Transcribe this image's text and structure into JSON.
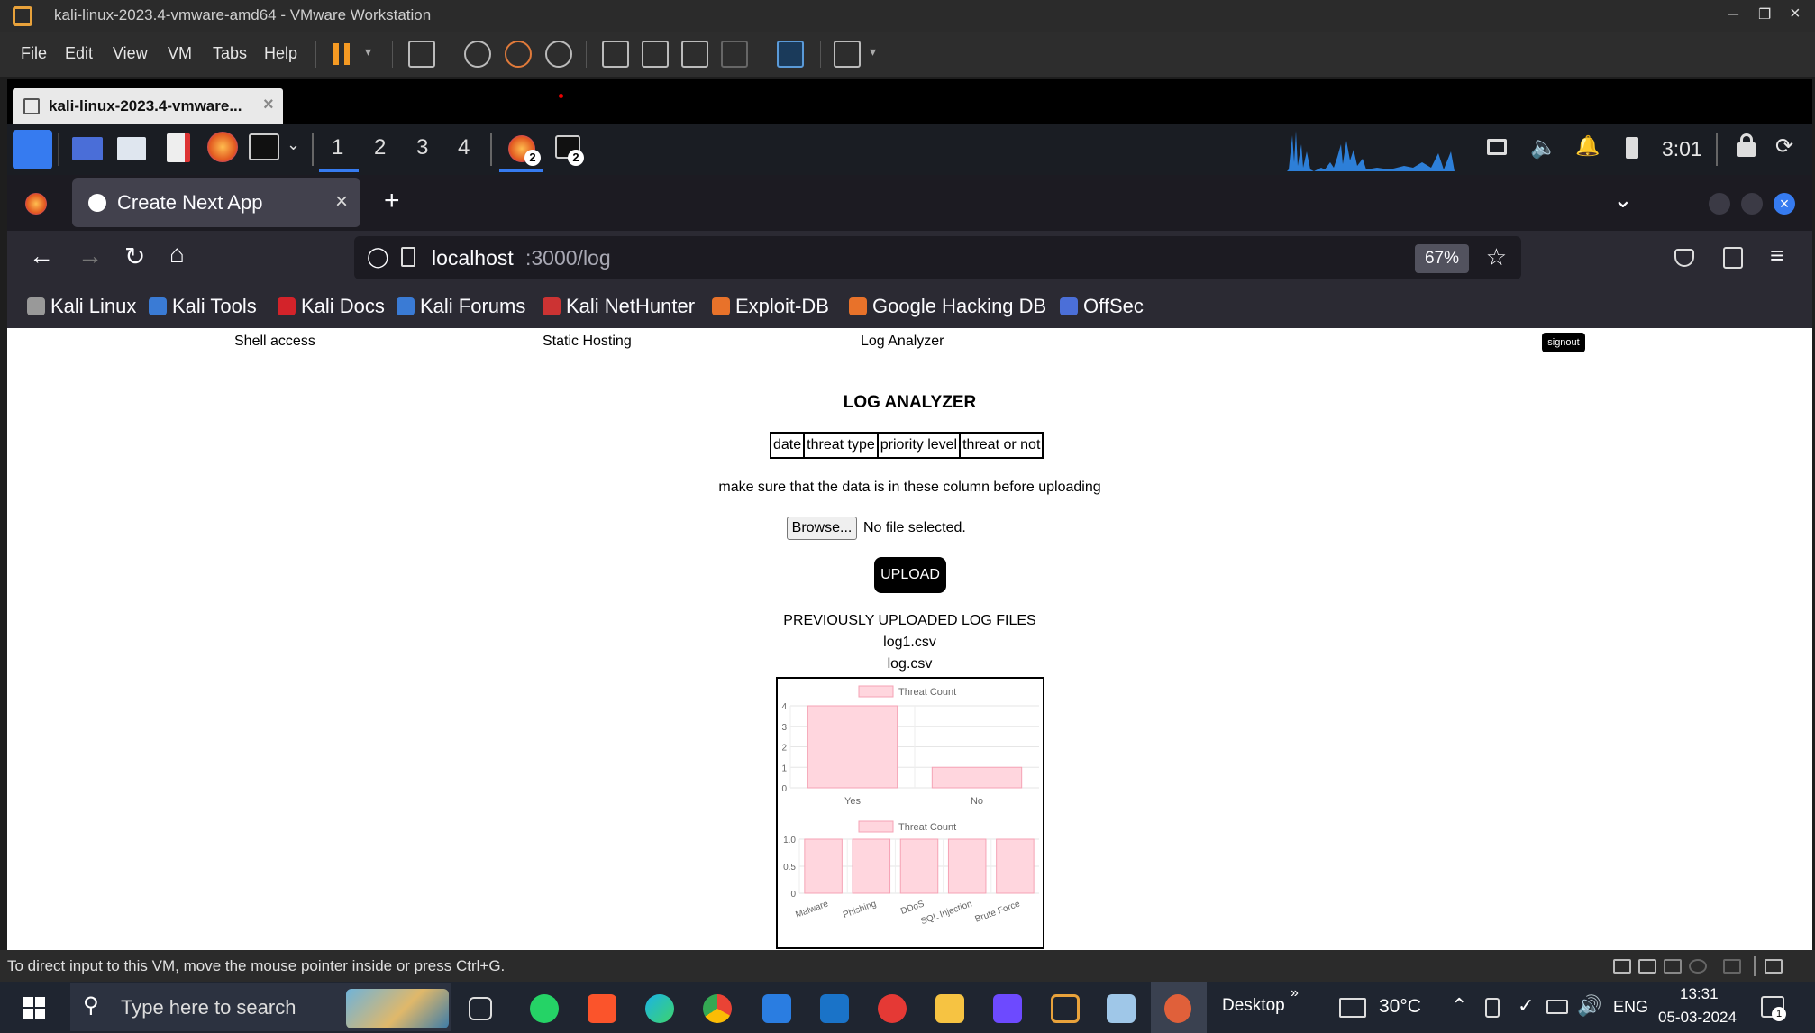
{
  "vmware": {
    "title": "kali-linux-2023.4-vmware-amd64 - VMware Workstation",
    "menu": [
      "File",
      "Edit",
      "View",
      "VM",
      "Tabs",
      "Help"
    ],
    "tab_label": "kali-linux-2023.4-vmware...",
    "status": "To direct input to this VM, move the mouse pointer inside or press Ctrl+G."
  },
  "kali_panel": {
    "workspaces": [
      "1",
      "2",
      "3",
      "4"
    ],
    "badge_count": "2",
    "clock": "3:01"
  },
  "browser": {
    "tab_title": "Create Next App",
    "url_host": "localhost",
    "url_path": ":3000/log",
    "zoom": "67%",
    "bookmarks": [
      "Kali Linux",
      "Kali Tools",
      "Kali Docs",
      "Kali Forums",
      "Kali NetHunter",
      "Exploit-DB",
      "Google Hacking DB",
      "OffSec"
    ]
  },
  "page": {
    "nav": [
      "Shell access",
      "Static Hosting",
      "Log Analyzer"
    ],
    "signout": "signout",
    "title": "LOG ANALYZER",
    "columns": [
      "date",
      "threat type",
      "priority level",
      "threat or not"
    ],
    "hint": "make sure that the data is in these column before uploading",
    "browse_label": "Browse...",
    "no_file": "No file selected.",
    "upload_label": "UPLOAD",
    "prev_heading": "PREVIOUSLY UPLOADED LOG FILES",
    "files": [
      "log1.csv",
      "log.csv"
    ]
  },
  "chart_data": [
    {
      "type": "bar",
      "legend": "Threat Count",
      "categories": [
        "Yes",
        "No"
      ],
      "values": [
        4,
        1
      ],
      "ylim": [
        0,
        4
      ],
      "yticks": [
        "4",
        "3",
        "2",
        "1",
        "0"
      ],
      "color": "#ffd6de",
      "border": "#f5a3b5"
    },
    {
      "type": "bar",
      "legend": "Threat Count",
      "categories": [
        "Malware",
        "Phishing",
        "DDoS",
        "SQL Injection",
        "Brute Force"
      ],
      "values": [
        1,
        1,
        1,
        1,
        1
      ],
      "ylim": [
        0,
        1
      ],
      "yticks": [
        "1.0",
        "0.5",
        "0"
      ],
      "color": "#ffd6de",
      "border": "#f5a3b5"
    }
  ],
  "taskbar": {
    "search_placeholder": "Type here to search",
    "desktop_label": "Desktop",
    "weather": "30°C",
    "lang": "ENG",
    "time": "13:31",
    "date": "05-03-2024"
  }
}
